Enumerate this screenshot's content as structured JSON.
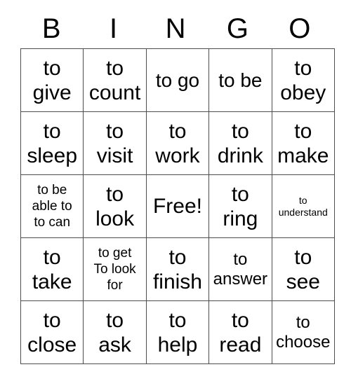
{
  "card": {
    "title": "BINGO",
    "headers": [
      "B",
      "I",
      "N",
      "G",
      "O"
    ],
    "free_space_label": "Free!",
    "border_color": "#4d4d4d",
    "text_color": "#000000",
    "background_color": "#ffffff",
    "rows": [
      [
        {
          "text": "to\ngive",
          "size": "fs-xl"
        },
        {
          "text": "to\ncount",
          "size": "fs-xl"
        },
        {
          "text": "to go",
          "size": "fs-lg"
        },
        {
          "text": "to be",
          "size": "fs-lg"
        },
        {
          "text": "to\nobey",
          "size": "fs-xl"
        }
      ],
      [
        {
          "text": "to\nsleep",
          "size": "fs-xl"
        },
        {
          "text": "to\nvisit",
          "size": "fs-xl"
        },
        {
          "text": "to\nwork",
          "size": "fs-xl"
        },
        {
          "text": "to\ndrink",
          "size": "fs-xl"
        },
        {
          "text": "to\nmake",
          "size": "fs-xl"
        }
      ],
      [
        {
          "text": "to be\nable to\nto can",
          "size": "fs-sm"
        },
        {
          "text": "to\nlook",
          "size": "fs-xl"
        },
        {
          "text": "Free!",
          "size": "fs-xl"
        },
        {
          "text": "to\nring",
          "size": "fs-xl"
        },
        {
          "text": "to\nunderstand",
          "size": "fs-xs"
        }
      ],
      [
        {
          "text": "to\ntake",
          "size": "fs-xl"
        },
        {
          "text": "to get\nTo look\nfor",
          "size": "fs-sm"
        },
        {
          "text": "to\nfinish",
          "size": "fs-xl"
        },
        {
          "text": "to\nanswer",
          "size": "fs-md"
        },
        {
          "text": "to\nsee",
          "size": "fs-xl"
        }
      ],
      [
        {
          "text": "to\nclose",
          "size": "fs-xl"
        },
        {
          "text": "to\nask",
          "size": "fs-xl"
        },
        {
          "text": "to\nhelp",
          "size": "fs-xl"
        },
        {
          "text": "to\nread",
          "size": "fs-xl"
        },
        {
          "text": "to\nchoose",
          "size": "fs-md"
        }
      ]
    ]
  }
}
